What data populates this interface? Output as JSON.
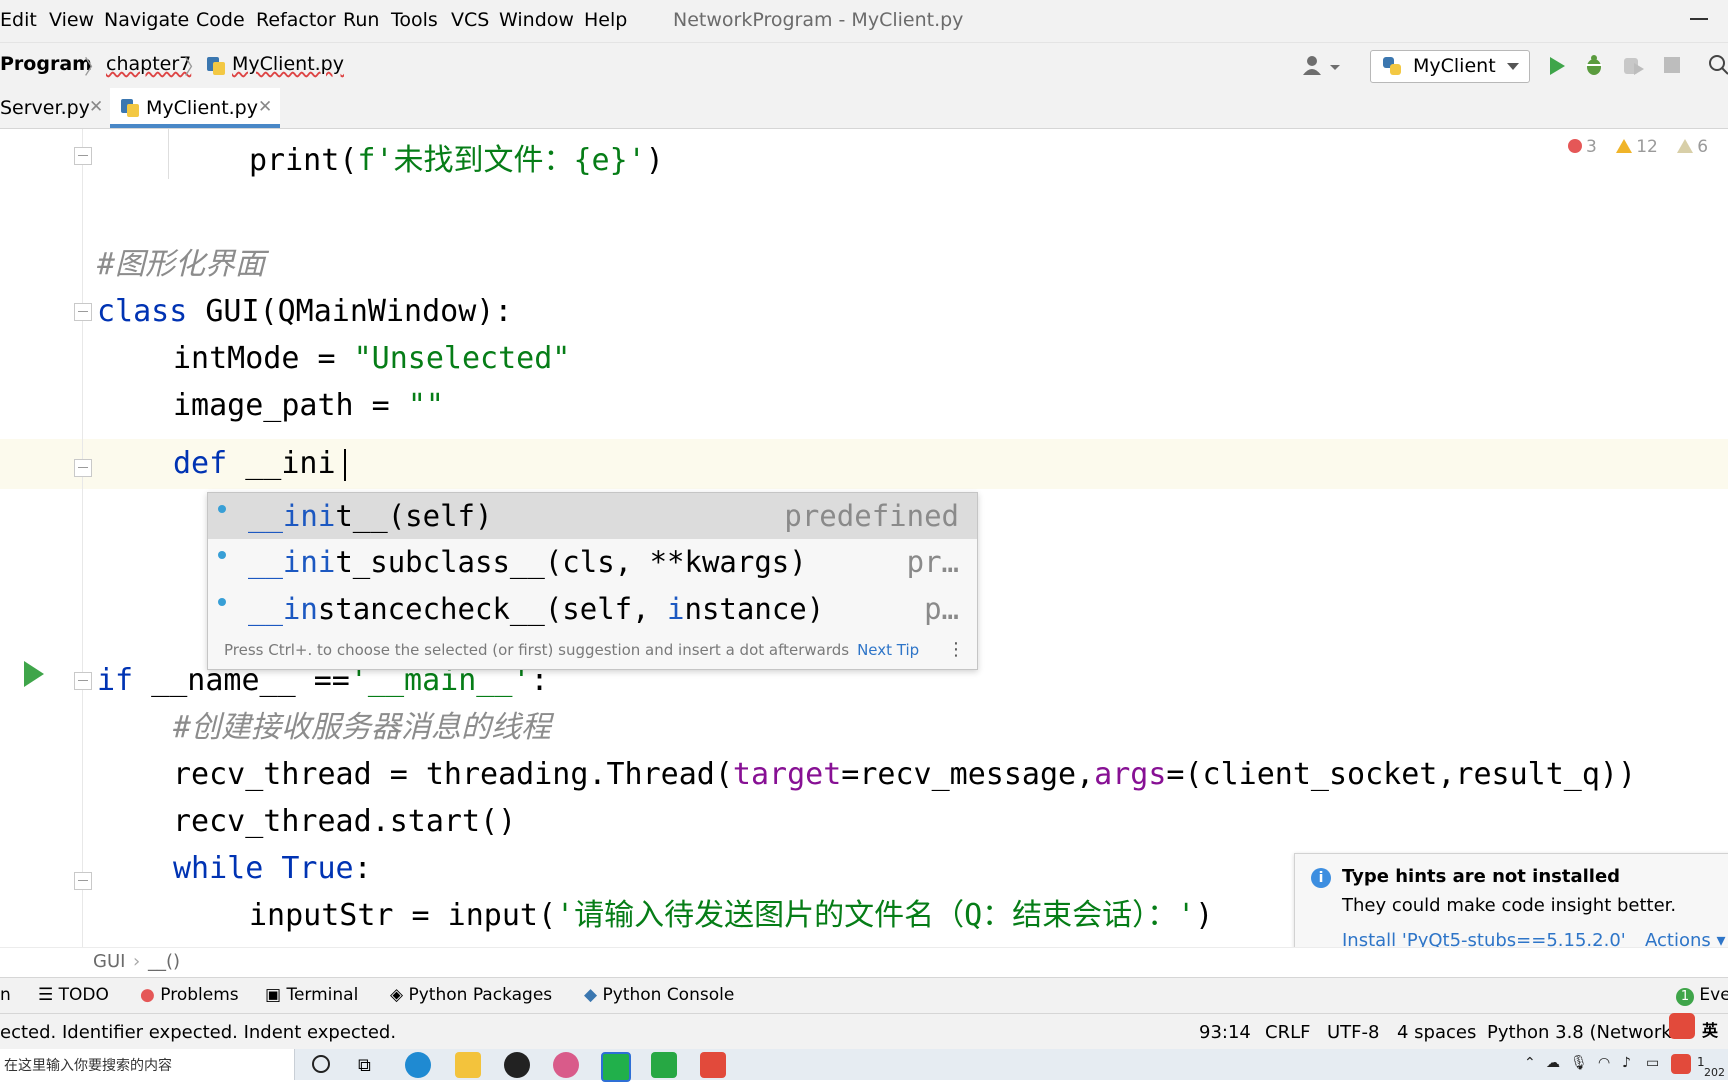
{
  "menubar": {
    "items": [
      "Edit",
      "View",
      "Navigate",
      "Code",
      "Refactor",
      "Run",
      "Tools",
      "VCS",
      "Window",
      "Help"
    ],
    "window_title": "NetworkProgram - MyClient.py"
  },
  "navbar": {
    "breadcrumbs": [
      "Program",
      "chapter7",
      "MyClient.py"
    ],
    "run_config": "MyClient"
  },
  "tabs": [
    {
      "label": "Server.py",
      "active": false
    },
    {
      "label": "MyClient.py",
      "active": true
    }
  ],
  "inspections": {
    "errors": "3",
    "warnings": "12",
    "weak_warnings": "6"
  },
  "code": {
    "line1": {
      "prefix": "print(",
      "str": "f'未找到文件：{e}'",
      "suffix": ")"
    },
    "comment1": "#图形化界面",
    "class_kw": "class",
    "class_rest": " GUI(QMainWindow):",
    "intmode_lhs": "intMode = ",
    "intmode_val": "\"Unselected\"",
    "image_lhs": "image_path = ",
    "image_val": "\"\"",
    "def_kw": "def",
    "def_rest": " __ini",
    "if_kw": "if",
    "if_rest": " __name__ ==",
    "if_str": "'__main__'",
    "if_end": ":",
    "comment2": "#创建接收服务器消息的线程",
    "recv_prefix": "recv_thread = threading.Thread(",
    "recv_p1": "target",
    "recv_mid": "=recv_message,",
    "recv_p2": "args",
    "recv_end": "=(client_socket,result_q))",
    "start_line": "recv_thread.start()",
    "while_kw": "while",
    "while_true": " True",
    "while_end": ":",
    "input_prefix": "inputStr = input(",
    "input_str": "'请输入待发送图片的文件名（Q：结束会话）：'",
    "input_end": ")"
  },
  "completion": {
    "items": [
      {
        "match": "__ini",
        "rest": "t__(self)",
        "type": "predefined"
      },
      {
        "match": "__ini",
        "rest": "t_subclass__(cls, **kwargs)",
        "type": "pr…"
      },
      {
        "match": "__in",
        "rest": "stancecheck__(self, ",
        "hl2": "i",
        "rest2": "nstance)",
        "type": "p…"
      }
    ],
    "tip": "Press Ctrl+. to choose the selected (or first) suggestion and insert a dot afterwards",
    "next_tip": "Next Tip"
  },
  "notification": {
    "title": "Type hints are not installed",
    "body": "They could make code insight better.",
    "install": "Install 'PyQt5-stubs==5.15.2.0'",
    "actions": "Actions ▾"
  },
  "editor_crumbs": [
    "GUI",
    "__()"
  ],
  "tool_windows": [
    "n",
    "TODO",
    "Problems",
    "Terminal",
    "Python Packages",
    "Python Console",
    "Eve"
  ],
  "status": {
    "message": "ected. Identifier expected. Indent expected.",
    "position": "93:14",
    "line_sep": "CRLF",
    "encoding": "UTF-8",
    "indent": "4 spaces",
    "interpreter": "Python 3.8 (NetworkP"
  },
  "taskbar": {
    "search_placeholder": "在这里输入你要搜索的内容",
    "ime": "英",
    "clock_top": "1",
    "clock_bottom": "202"
  }
}
